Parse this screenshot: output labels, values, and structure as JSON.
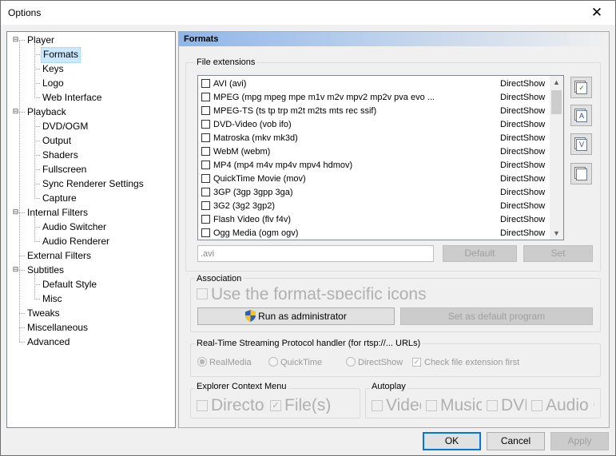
{
  "window": {
    "title": "Options",
    "close_glyph": "✕"
  },
  "tree": {
    "items": [
      {
        "label": "Player",
        "level": 0,
        "expander": "⊟"
      },
      {
        "label": "Formats",
        "level": 1,
        "selected": true
      },
      {
        "label": "Keys",
        "level": 1
      },
      {
        "label": "Logo",
        "level": 1
      },
      {
        "label": "Web Interface",
        "level": 1
      },
      {
        "label": "Playback",
        "level": 0,
        "expander": "⊟"
      },
      {
        "label": "DVD/OGM",
        "level": 1
      },
      {
        "label": "Output",
        "level": 1
      },
      {
        "label": "Shaders",
        "level": 1
      },
      {
        "label": "Fullscreen",
        "level": 1
      },
      {
        "label": "Sync Renderer Settings",
        "level": 1
      },
      {
        "label": "Capture",
        "level": 1
      },
      {
        "label": "Internal Filters",
        "level": 0,
        "expander": "⊟"
      },
      {
        "label": "Audio Switcher",
        "level": 1
      },
      {
        "label": "Audio Renderer",
        "level": 1
      },
      {
        "label": "External Filters",
        "level": 0
      },
      {
        "label": "Subtitles",
        "level": 0,
        "expander": "⊟"
      },
      {
        "label": "Default Style",
        "level": 1
      },
      {
        "label": "Misc",
        "level": 1
      },
      {
        "label": "Tweaks",
        "level": 0
      },
      {
        "label": "Miscellaneous",
        "level": 0
      },
      {
        "label": "Advanced",
        "level": 0
      }
    ]
  },
  "page": {
    "header": "Formats",
    "file_extensions": {
      "label": "File extensions",
      "rows": [
        {
          "name": "AVI (avi)",
          "handler": "DirectShow"
        },
        {
          "name": "MPEG (mpg mpeg mpe m1v m2v mpv2 mp2v pva evo ...",
          "handler": "DirectShow"
        },
        {
          "name": "MPEG-TS (ts tp trp m2t m2ts mts rec ssif)",
          "handler": "DirectShow"
        },
        {
          "name": "DVD-Video (vob ifo)",
          "handler": "DirectShow"
        },
        {
          "name": "Matroska (mkv mk3d)",
          "handler": "DirectShow"
        },
        {
          "name": "WebM (webm)",
          "handler": "DirectShow"
        },
        {
          "name": "MP4 (mp4 m4v mp4v mpv4 hdmov)",
          "handler": "DirectShow"
        },
        {
          "name": "QuickTime Movie (mov)",
          "handler": "DirectShow"
        },
        {
          "name": "3GP (3gp 3gpp 3ga)",
          "handler": "DirectShow"
        },
        {
          "name": "3G2 (3g2 3gp2)",
          "handler": "DirectShow"
        },
        {
          "name": "Flash Video (flv f4v)",
          "handler": "DirectShow"
        },
        {
          "name": "Ogg Media (ogm ogv)",
          "handler": "DirectShow"
        }
      ],
      "ext_value": ".avi",
      "default_label": "Default",
      "set_label": "Set",
      "side_buttons": [
        "check-all-icon",
        "audio-icon",
        "video-icon",
        "copy-icon"
      ],
      "side_glyphs": [
        "✓",
        "A",
        "V",
        ""
      ]
    },
    "association": {
      "label": "Association",
      "icons_text": "Use the format-specific icons",
      "run_admin_label": "Run as administrator",
      "set_default_label": "Set as default program"
    },
    "rtsp": {
      "label": "Real-Time Streaming Protocol handler (for rtsp://... URLs)",
      "options": [
        "RealMedia",
        "QuickTime",
        "DirectShow"
      ],
      "check_label": "Check file extension first"
    },
    "explorer": {
      "label": "Explorer Context Menu",
      "items": [
        "Directory",
        "File(s)"
      ]
    },
    "autoplay": {
      "label": "Autoplay",
      "items": [
        "Video",
        "Music",
        "DVD",
        "Audio CD"
      ]
    }
  },
  "footer": {
    "ok": "OK",
    "cancel": "Cancel",
    "apply": "Apply"
  }
}
